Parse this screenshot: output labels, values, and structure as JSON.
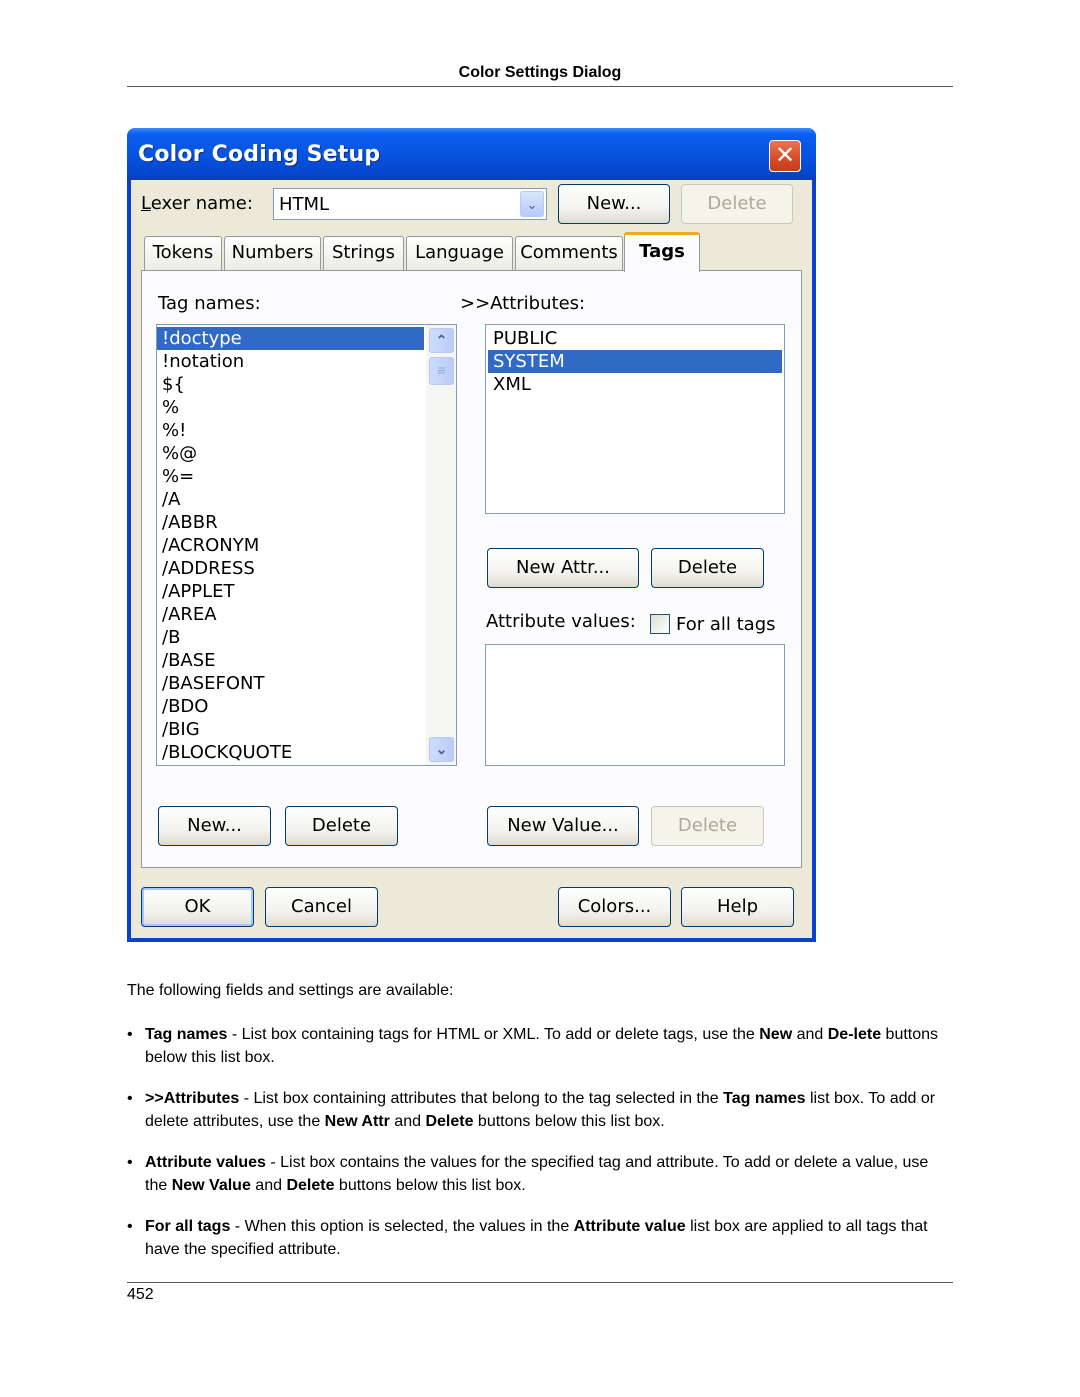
{
  "page": {
    "header": "Color Settings Dialog",
    "page_number": "452"
  },
  "dialog": {
    "title": "Color Coding Setup",
    "close_glyph": "✕",
    "lexer_label_accel": "L",
    "lexer_label_rest": "exer name:",
    "lexer_value": "HTML",
    "combo_arrow_glyph": "⌄",
    "top_buttons": {
      "new": "New...",
      "delete": "Delete"
    },
    "tabs": [
      {
        "label": "Tokens"
      },
      {
        "label": "Numbers"
      },
      {
        "label": "Strings"
      },
      {
        "label": "Language"
      },
      {
        "label": "Comments"
      },
      {
        "label": "Tags",
        "active": true
      }
    ],
    "tags_panel": {
      "tag_names_label": "Tag names:",
      "attributes_label": ">>Attributes:",
      "tag_names": [
        "!doctype",
        "!notation",
        "${",
        "%",
        "%!",
        "%@",
        "%=",
        "/A",
        "/ABBR",
        "/ACRONYM",
        "/ADDRESS",
        "/APPLET",
        "/AREA",
        "/B",
        "/BASE",
        "/BASEFONT",
        "/BDO",
        "/BIG",
        "/BLOCKQUOTE"
      ],
      "selected_tag": "!doctype",
      "attributes": [
        "PUBLIC",
        "SYSTEM",
        "XML"
      ],
      "selected_attribute": "SYSTEM",
      "new_attr_button": "New Attr...",
      "delete_attr_button": "Delete",
      "attribute_values_label": "Attribute values:",
      "for_all_tags_label": "For all tags",
      "for_all_tags_checked": false,
      "attribute_values": [],
      "new_tag_button": "New...",
      "delete_tag_button": "Delete",
      "new_value_button": "New Value...",
      "delete_value_button": "Delete",
      "scroll_up_glyph": "⌃",
      "scroll_down_glyph": "⌄",
      "scroll_thumb_glyph": "≡"
    },
    "bottom_buttons": {
      "ok": "OK",
      "cancel": "Cancel",
      "colors": "Colors...",
      "help": "Help"
    }
  },
  "doc": {
    "intro": "The following fields and settings are available:",
    "bullet_glyph": "•",
    "bullets": [
      {
        "parts": [
          {
            "b": "Tag names"
          },
          {
            "t": " - List box containing tags for HTML or XML. To add or delete tags, use the "
          },
          {
            "b": "New"
          },
          {
            "t": " and "
          },
          {
            "b": "De-lete"
          },
          {
            "t": " buttons below this list box."
          }
        ]
      },
      {
        "parts": [
          {
            "b": ">>Attributes"
          },
          {
            "t": " - List box containing attributes that belong to the tag selected in the "
          },
          {
            "b": "Tag names"
          },
          {
            "t": " list box. To add or delete attributes, use the "
          },
          {
            "b": "New Attr"
          },
          {
            "t": " and "
          },
          {
            "b": "Delete"
          },
          {
            "t": " buttons below this list box."
          }
        ]
      },
      {
        "parts": [
          {
            "b": "Attribute values"
          },
          {
            "t": " - List box contains the values for the specified tag and attribute. To add or delete a value, use the "
          },
          {
            "b": "New Value"
          },
          {
            "t": " and "
          },
          {
            "b": "Delete"
          },
          {
            "t": " buttons below this list box."
          }
        ]
      },
      {
        "parts": [
          {
            "b": "For all tags"
          },
          {
            "t": " - When this option is selected, the values in the "
          },
          {
            "b": "Attribute value"
          },
          {
            "t": " list box are applied to all tags that have the specified attribute."
          }
        ]
      }
    ]
  },
  "colors": {
    "titlebar_blue": "#0654e0",
    "selection_blue": "#316ac5",
    "dialog_face": "#ece9d8",
    "active_tab_accent": "#f5a623",
    "close_red": "#d9502b"
  }
}
